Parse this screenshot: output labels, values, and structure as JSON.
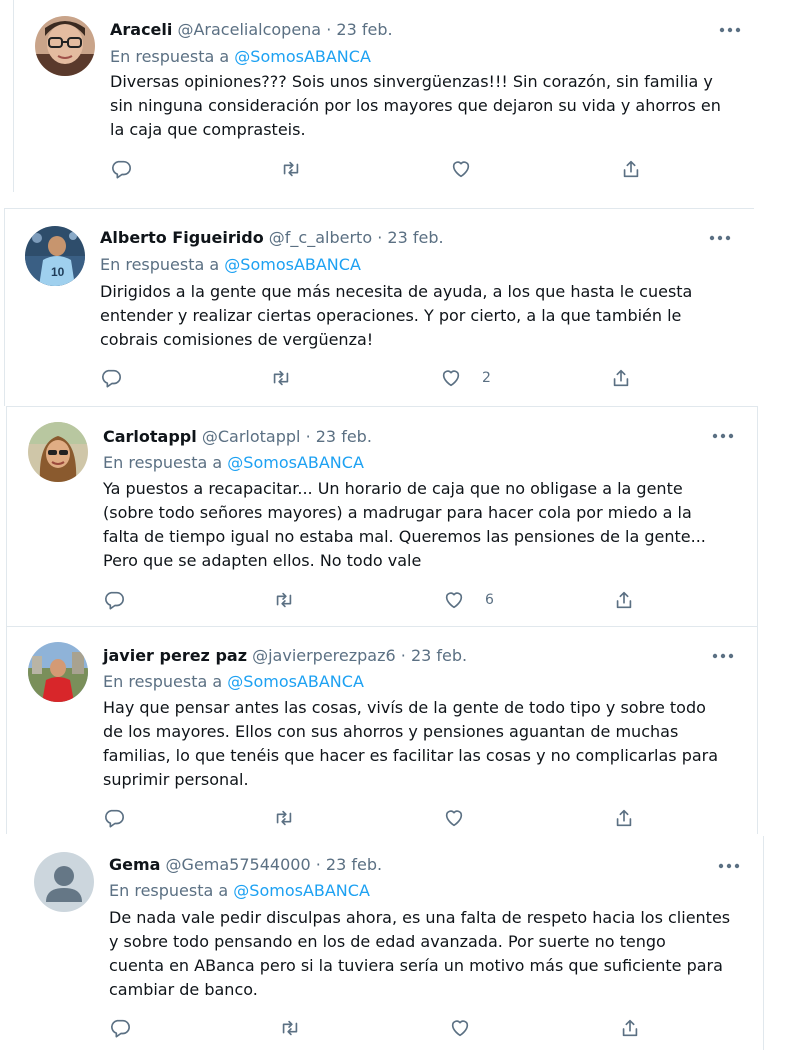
{
  "replying_to_label": "En respuesta a",
  "date_separator": "·",
  "icons": {
    "reply": "reply-icon",
    "retweet": "retweet-icon",
    "like": "like-icon",
    "share": "share-icon",
    "more": "more-icon"
  },
  "colors": {
    "link": "#1da1f2",
    "muted": "#5b7083",
    "text": "#0f1419"
  },
  "tweets": [
    {
      "name": "Araceli",
      "handle": "@Aracelialcopena",
      "date": "23 feb.",
      "mention": "@SomosABANCA",
      "text": "Diversas opiniones??? Sois unos sinvergüenzas!!! Sin corazón, sin familia y\nsin ninguna consideración por los mayores que dejaron su vida y ahorros en\nla caja que comprasteis.",
      "likes": ""
    },
    {
      "name": "Alberto Figueirido",
      "handle": "@f_c_alberto",
      "date": "23 feb.",
      "mention": "@SomosABANCA",
      "text": "Dirigidos a la gente que más necesita de ayuda, a los que hasta le cuesta\nentender y realizar ciertas operaciones. Y por cierto, a la que también le\ncobrais comisiones de vergüenza!",
      "likes": "2"
    },
    {
      "name": "Carlotappl",
      "handle": "@Carlotappl",
      "date": "23 feb.",
      "mention": "@SomosABANCA",
      "text": "Ya puestos a recapacitar... Un horario de caja que no obligase a la gente\n(sobre todo señores mayores) a madrugar para hacer cola por miedo a la\nfalta de tiempo igual no estaba mal. Queremos las pensiones de la gente...\nPero que se adapten ellos. No todo vale",
      "likes": "6"
    },
    {
      "name": "javier perez paz",
      "handle": "@javierperezpaz6",
      "date": "23 feb.",
      "mention": "@SomosABANCA",
      "text": "Hay que pensar antes las cosas, vivís de la gente de todo tipo y sobre todo\nde los mayores. Ellos con sus ahorros y pensiones aguantan de muchas\nfamilias, lo que tenéis que hacer es facilitar las cosas y no complicarlas para\nsuprimir personal.",
      "likes": ""
    },
    {
      "name": "Gema",
      "handle": "@Gema57544000",
      "date": "23 feb.",
      "mention": "@SomosABANCA",
      "text": "De nada vale pedir disculpas ahora, es una falta de respeto hacia los clientes\ny sobre todo pensando en los de edad avanzada. Por suerte no tengo\ncuenta en ABanca pero si la tuviera sería un motivo más que suficiente para\ncambiar de banco.",
      "likes": ""
    }
  ]
}
